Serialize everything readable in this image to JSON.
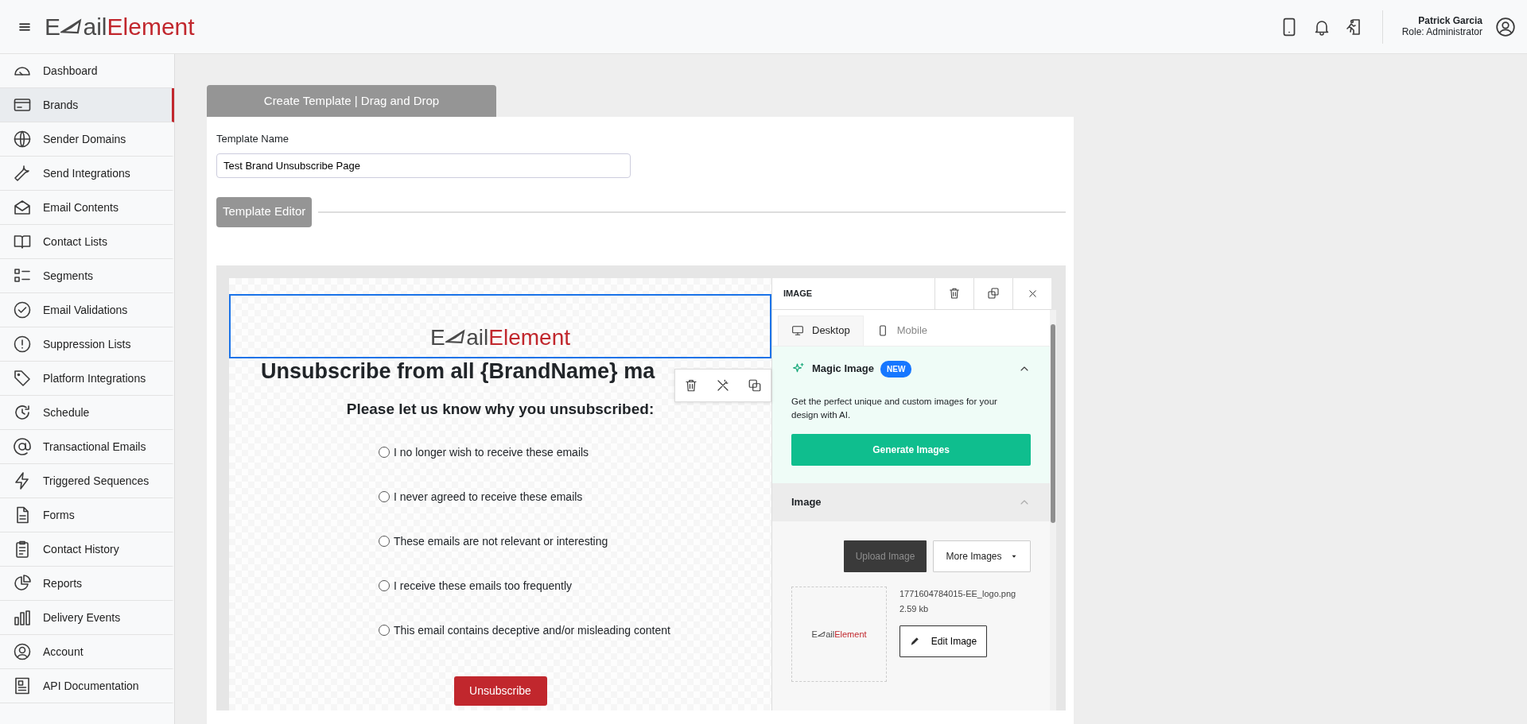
{
  "header": {
    "logo": {
      "lead": "E",
      "mid": "ail",
      "brand": "Element"
    },
    "user": {
      "name": "Patrick Garcia",
      "role": "Role: Administrator"
    }
  },
  "sidebar": {
    "items": [
      {
        "label": "Dashboard",
        "selected": false
      },
      {
        "label": "Brands",
        "selected": true
      },
      {
        "label": "Sender Domains",
        "selected": false
      },
      {
        "label": "Send Integrations",
        "selected": false
      },
      {
        "label": "Email Contents",
        "selected": false
      },
      {
        "label": "Contact Lists",
        "selected": false
      },
      {
        "label": "Segments",
        "selected": false
      },
      {
        "label": "Email Validations",
        "selected": false
      },
      {
        "label": "Suppression Lists",
        "selected": false
      },
      {
        "label": "Platform Integrations",
        "selected": false
      },
      {
        "label": "Schedule",
        "selected": false
      },
      {
        "label": "Transactional Emails",
        "selected": false
      },
      {
        "label": "Triggered Sequences",
        "selected": false
      },
      {
        "label": "Forms",
        "selected": false
      },
      {
        "label": "Contact History",
        "selected": false
      },
      {
        "label": "Reports",
        "selected": false
      },
      {
        "label": "Delivery Events",
        "selected": false
      },
      {
        "label": "Account",
        "selected": false
      },
      {
        "label": "API Documentation",
        "selected": false
      }
    ]
  },
  "page_tab": {
    "label": "Create Template | Drag and Drop"
  },
  "template_name": {
    "label": "Template Name",
    "value": "Test Brand Unsubscribe Page"
  },
  "editor_button": "Template Editor",
  "email_canvas": {
    "logo": {
      "lead": "E",
      "mid": "ail",
      "brand": "Element"
    },
    "heading": "Unsubscribe from all {BrandName} ma",
    "subheading": "Please let us know why you unsubscribed:",
    "options": [
      {
        "label": "I no longer wish to receive these emails",
        "selected": false
      },
      {
        "label": "I never agreed to receive these emails",
        "selected": false
      },
      {
        "label": "These emails are not relevant or interesting",
        "selected": false
      },
      {
        "label": "I receive these emails too frequently",
        "selected": false
      },
      {
        "label": "This email contains deceptive and/or misleading content",
        "selected": false
      }
    ],
    "button": "Unsubscribe"
  },
  "properties_panel": {
    "title": "IMAGE",
    "tabs": [
      {
        "label": "Desktop",
        "selected": true
      },
      {
        "label": "Mobile",
        "selected": false
      }
    ],
    "magic": {
      "title": "Magic Image",
      "badge": "NEW",
      "expanded": true,
      "description": "Get the perfect unique and custom images for your design with AI.",
      "button": "Generate Images"
    },
    "image_section": {
      "title": "Image",
      "expanded": true,
      "upload_button": "Upload Image",
      "more_button": "More Images",
      "thumbnail_logo": {
        "lead": "E",
        "mid": "ail",
        "brand": "Element"
      },
      "file_name": "1771604784015-EE_logo.png",
      "file_size": "2.59 kb",
      "edit_button": "Edit Image"
    }
  }
}
